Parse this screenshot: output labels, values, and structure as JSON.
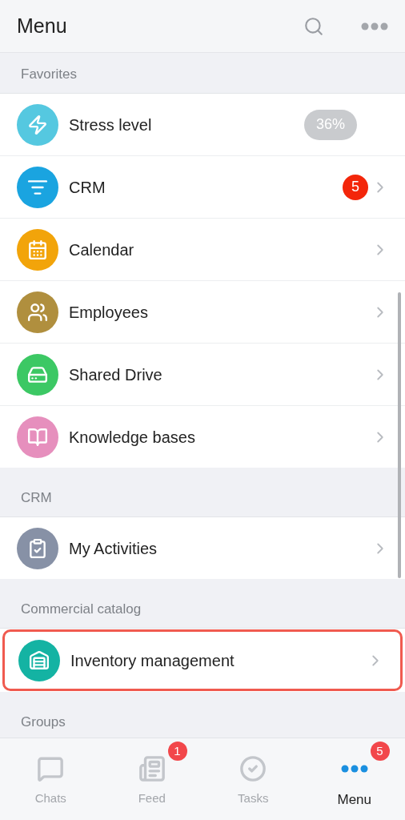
{
  "header": {
    "title": "Menu"
  },
  "sections": [
    {
      "title": "Favorites",
      "items": [
        {
          "label": "Stress level",
          "color": "#55c8e0",
          "kind": "meter",
          "badge": "36%",
          "highlighted": false
        },
        {
          "label": "CRM",
          "color": "#1aa4e0",
          "kind": "counter",
          "badge": "5",
          "highlighted": false
        },
        {
          "label": "Calendar",
          "color": "#f2a40a",
          "kind": "link",
          "highlighted": false
        },
        {
          "label": "Employees",
          "color": "#b08f3e",
          "kind": "link",
          "highlighted": false
        },
        {
          "label": "Shared Drive",
          "color": "#3cc864",
          "kind": "link",
          "highlighted": false
        },
        {
          "label": "Knowledge bases",
          "color": "#e68fbd",
          "kind": "link",
          "highlighted": false
        }
      ]
    },
    {
      "title": "CRM",
      "items": [
        {
          "label": "My Activities",
          "color": "#8791a6",
          "kind": "link",
          "highlighted": false
        }
      ]
    },
    {
      "title": "Commercial catalog",
      "items": [
        {
          "label": "Inventory management",
          "color": "#14b3a3",
          "kind": "link",
          "highlighted": true
        }
      ]
    },
    {
      "title": "Groups"
    }
  ],
  "tabs": [
    {
      "label": "Chats",
      "selected": false
    },
    {
      "label": "Feed",
      "selected": false,
      "badge": "1"
    },
    {
      "label": "Tasks",
      "selected": false
    },
    {
      "label": "Menu",
      "selected": true,
      "badge": "5"
    }
  ]
}
